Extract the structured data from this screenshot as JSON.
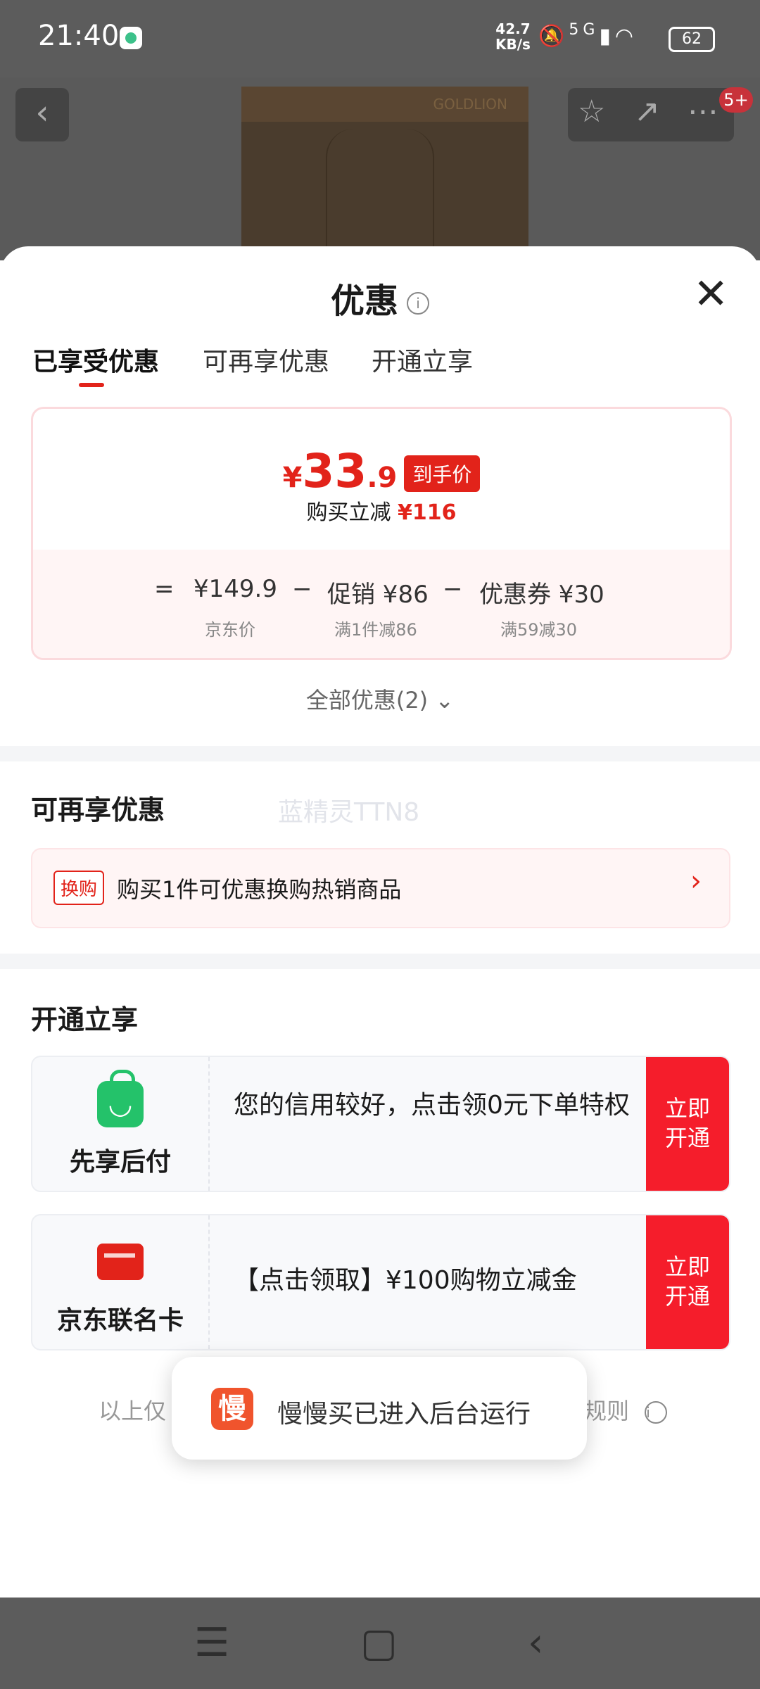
{
  "status_bar": {
    "time": "21:40",
    "net_speed_value": "42.7",
    "net_speed_unit": "KB/s",
    "network": "5G",
    "battery": "62"
  },
  "product_nav": {
    "back_icon": "chevron-left-icon",
    "product_brand_text": "GOLDLION",
    "badge": "5+"
  },
  "sheet": {
    "title": "优惠",
    "info_icon": "i"
  },
  "tabs": [
    {
      "label": "已享受优惠",
      "active": true
    },
    {
      "label": "可再享优惠",
      "active": false
    },
    {
      "label": "开通立享",
      "active": false
    }
  ],
  "price_card": {
    "currency": "¥",
    "price_int": "33",
    "price_dec": ".9",
    "price_tag": "到手价",
    "subtract_label": "购买立减",
    "subtract_value": "¥116",
    "eq": "=",
    "minus": "−",
    "jd_price": "¥149.9",
    "jd_price_label": "京东价",
    "promo": "促销 ¥86",
    "promo_label": "满1件减86",
    "coupon": "优惠券 ¥30",
    "coupon_label": "满59减30"
  },
  "all_promos": "全部优惠(2)",
  "resale": {
    "title": "可再享优惠",
    "watermark": "蓝精灵TTN8",
    "tag": "换购",
    "text": "购买1件可优惠换购热销商品"
  },
  "open_section": {
    "title": "开通立享",
    "items": [
      {
        "name": "先享后付",
        "desc": "您的信用较好，点击领0元下单特权",
        "btn_line1": "立即",
        "btn_line2": "开通"
      },
      {
        "name": "京东联名卡",
        "desc": "【点击领取】¥100购物立减金",
        "btn_line1": "立即",
        "btn_line2": "开通"
      }
    ]
  },
  "disclaimer_left": "以上仅",
  "disclaimer_right": "规则",
  "toast": {
    "logo": "慢",
    "message": "慢慢买已进入后台运行"
  },
  "colors": {
    "accent": "#e2231a",
    "button": "#f51d2b",
    "green": "#24c26a"
  }
}
